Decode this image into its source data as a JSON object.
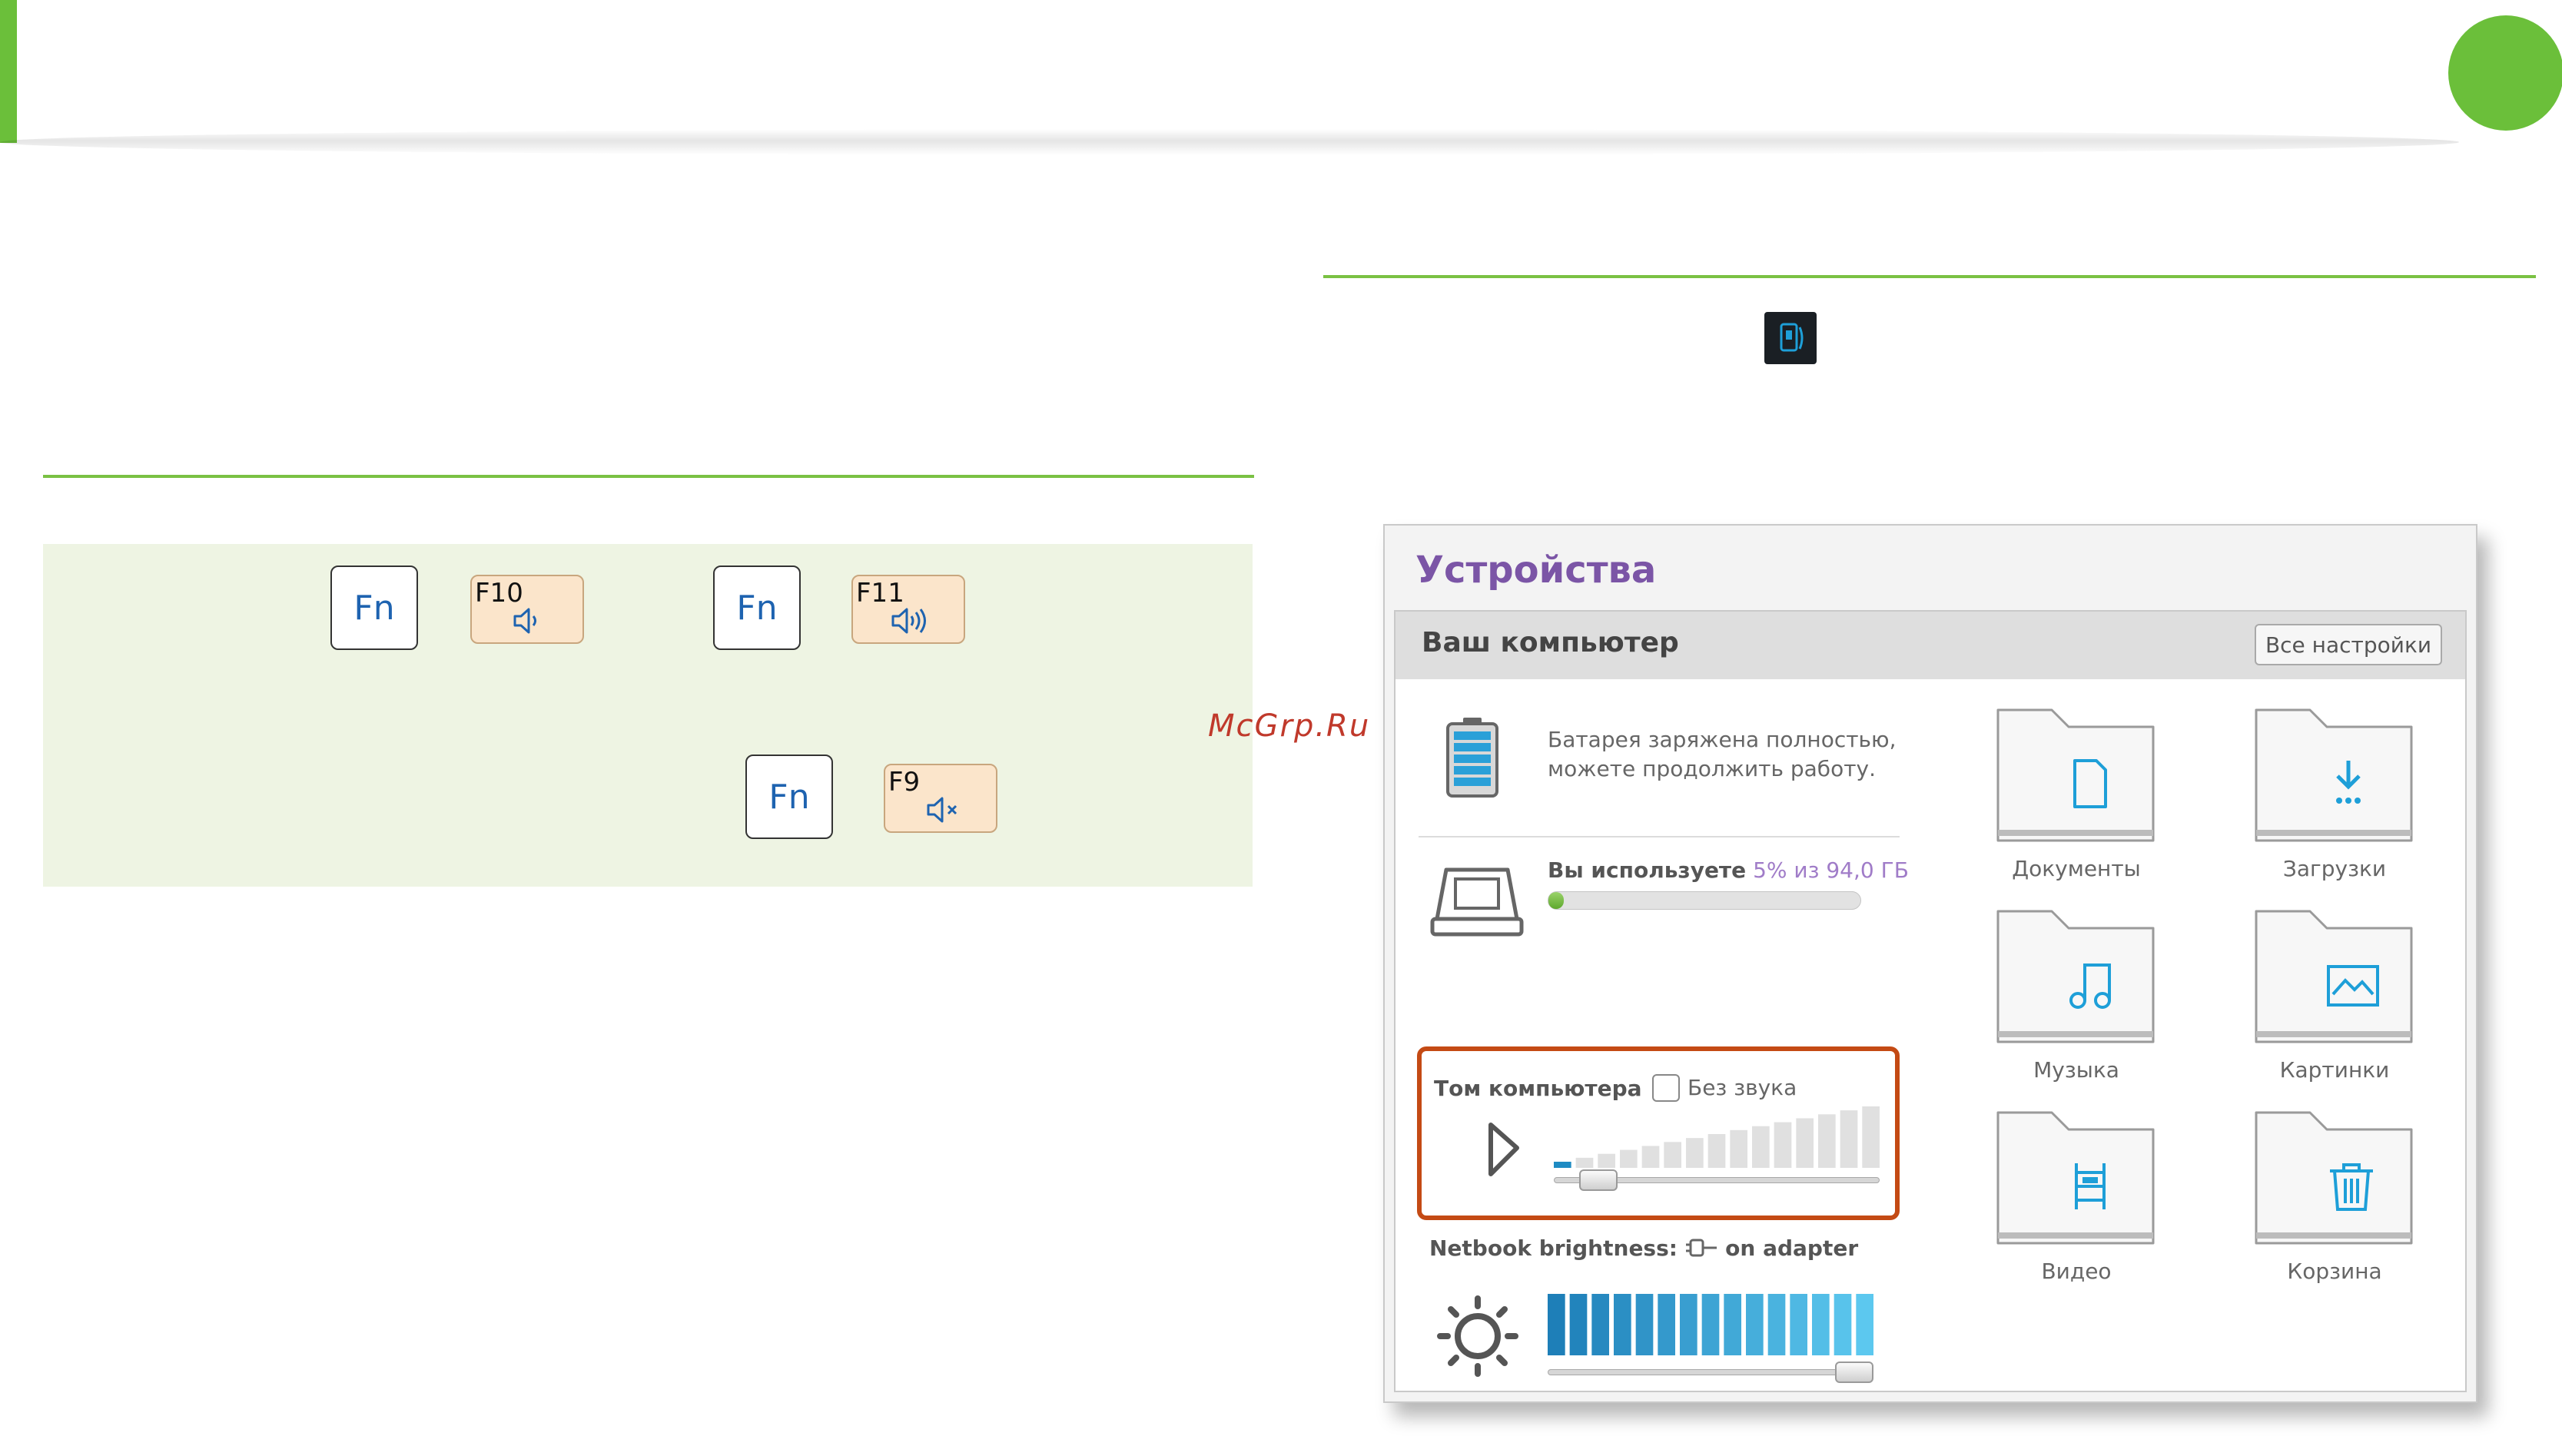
{
  "keys": {
    "row1": [
      {
        "fn": "Fn",
        "fkey": "F10",
        "icon": "volume-down-icon"
      },
      {
        "fn": "Fn",
        "fkey": "F11",
        "icon": "volume-up-icon"
      }
    ],
    "row2": {
      "fn": "Fn",
      "fkey": "F9",
      "icon": "mute-icon"
    }
  },
  "watermark": "McGrp.Ru",
  "screenshot": {
    "title": "Устройства",
    "header": {
      "title": "Ваш компьютер",
      "settings_button": "Все настройки"
    },
    "battery": {
      "text_line1": "Батарея заряжена полностью,",
      "text_line2": "можете продолжить работу.",
      "icon": "battery-icon"
    },
    "storage": {
      "label": "Вы используете",
      "usage": "5% из 94,0 ГБ",
      "used_fraction": 0.05,
      "icon": "laptop-icon"
    },
    "volume": {
      "label": "Том компьютера",
      "mute_label": "Без звука",
      "muted": false,
      "level_fraction": 0.05,
      "icon": "speaker-icon"
    },
    "brightness": {
      "label": "Netbook brightness:",
      "source": "on adapter",
      "level_fraction": 1.0,
      "icon": "sun-icon",
      "plug_icon": "plug-icon"
    },
    "folders": [
      {
        "label": "Документы",
        "icon": "document-icon"
      },
      {
        "label": "Загрузки",
        "icon": "download-icon"
      },
      {
        "label": "Музыка",
        "icon": "music-icon"
      },
      {
        "label": "Картинки",
        "icon": "picture-icon"
      },
      {
        "label": "Видео",
        "icon": "video-icon"
      },
      {
        "label": "Корзина",
        "icon": "trash-icon"
      }
    ]
  },
  "colors": {
    "accent_green": "#7ac143",
    "title_purple": "#7b55a6",
    "highlight_orange": "#c44a14",
    "blue": "#1e8bc3"
  }
}
